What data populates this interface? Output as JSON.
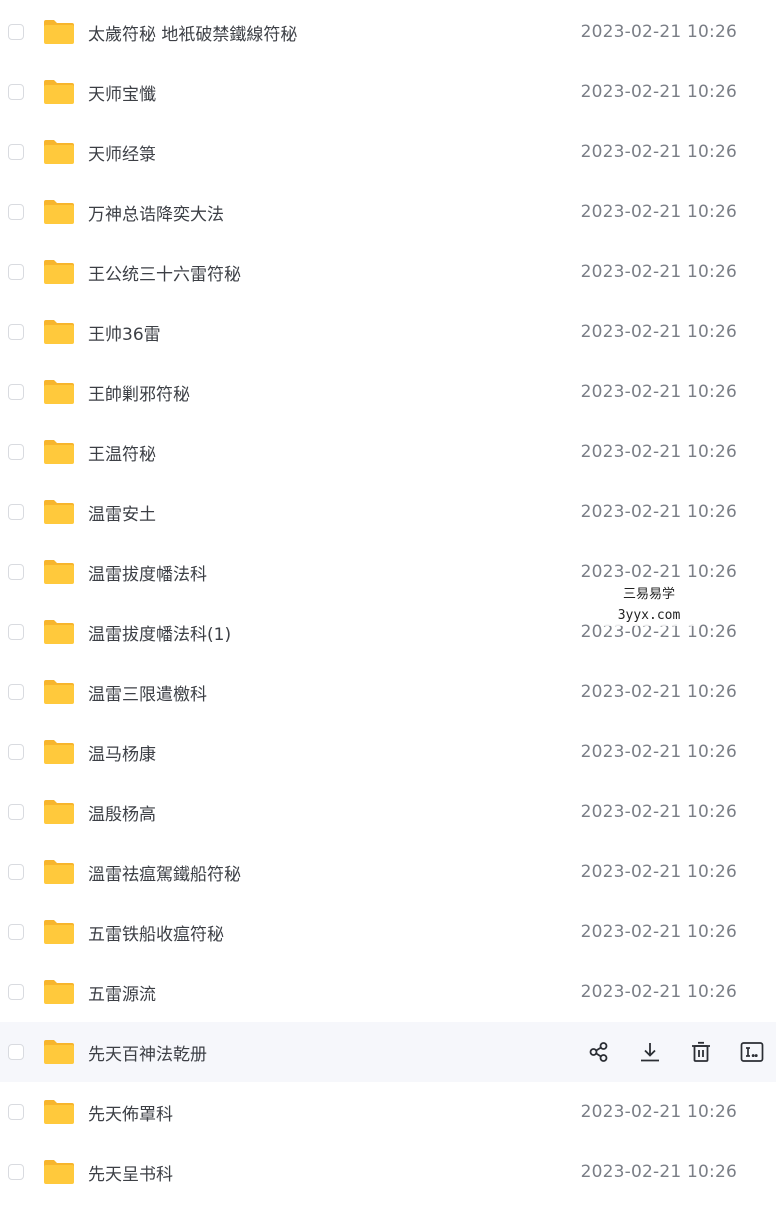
{
  "rows": [
    {
      "name": "太歲符秘 地衹破禁鐵線符秘",
      "date": "2023-02-21 10:26"
    },
    {
      "name": "天师宝懺",
      "date": "2023-02-21 10:26"
    },
    {
      "name": "天师经箓",
      "date": "2023-02-21 10:26"
    },
    {
      "name": "万神总诰降奕大法",
      "date": "2023-02-21 10:26"
    },
    {
      "name": "王公统三十六雷符秘",
      "date": "2023-02-21 10:26"
    },
    {
      "name": "王帅36雷",
      "date": "2023-02-21 10:26"
    },
    {
      "name": "王帥剿邪符秘",
      "date": "2023-02-21 10:26"
    },
    {
      "name": "王温符秘",
      "date": "2023-02-21 10:26"
    },
    {
      "name": "温雷安土",
      "date": "2023-02-21 10:26"
    },
    {
      "name": "温雷拔度幡法科",
      "date": "2023-02-21 10:26"
    },
    {
      "name": "温雷拔度幡法科(1)",
      "date": "2023-02-21 10:26"
    },
    {
      "name": "温雷三限遣檄科",
      "date": "2023-02-21 10:26"
    },
    {
      "name": "温马杨康",
      "date": "2023-02-21 10:26"
    },
    {
      "name": "温殷杨高",
      "date": "2023-02-21 10:26"
    },
    {
      "name": "溫雷祛瘟駕鐵船符秘",
      "date": "2023-02-21 10:26"
    },
    {
      "name": "五雷铁船收瘟符秘",
      "date": "2023-02-21 10:26"
    },
    {
      "name": "五雷源流",
      "date": "2023-02-21 10:26"
    },
    {
      "name": "先天百神法乾册",
      "date": "",
      "hover": true
    },
    {
      "name": "先天佈罩科",
      "date": "2023-02-21 10:26"
    },
    {
      "name": "先天呈书科",
      "date": "2023-02-21 10:26"
    }
  ],
  "hover_actions": [
    "share-icon",
    "download-icon",
    "delete-icon",
    "rename-icon"
  ],
  "watermark": {
    "line1": "三易易学",
    "line2": "3yyx.com"
  },
  "colors": {
    "folder": "#ffc93c",
    "folder_tab": "#f7b52c",
    "hover_bg": "#f6f7fb",
    "icon": "#2b2e34"
  }
}
